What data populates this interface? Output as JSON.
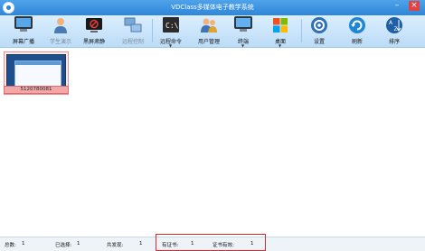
{
  "window": {
    "title": "VDClass多媒体电子教学系统"
  },
  "toolbar": {
    "items": [
      {
        "label": "屏幕广播",
        "icon": "monitor-broadcast-icon",
        "enabled": true
      },
      {
        "label": "学生演示",
        "icon": "student-demo-icon",
        "enabled": false
      },
      {
        "label": "黑屏肃静",
        "icon": "black-screen-icon",
        "enabled": true
      },
      {
        "label": "远程控制",
        "icon": "remote-control-icon",
        "enabled": false
      },
      {
        "label": "远程命令",
        "icon": "remote-command-icon",
        "enabled": true,
        "dropdown": true
      },
      {
        "label": "用户管理",
        "icon": "user-management-icon",
        "enabled": true
      },
      {
        "label": "终端",
        "icon": "terminal-icon",
        "enabled": true,
        "dropdown": true
      },
      {
        "label": "桌面",
        "icon": "desktop-icon",
        "enabled": true,
        "dropdown": true
      },
      {
        "label": "设置",
        "icon": "settings-icon",
        "enabled": true
      },
      {
        "label": "刷新",
        "icon": "refresh-icon",
        "enabled": true
      },
      {
        "label": "排序",
        "icon": "sort-icon",
        "enabled": true
      }
    ]
  },
  "students": [
    {
      "name": "5120780081"
    }
  ],
  "status": {
    "total_label": "总数:",
    "total_value": "1",
    "selected_label": "已选择:",
    "selected_value": "1",
    "found_label": "共发现:",
    "found_value": "1",
    "cert_label": "有证书:",
    "cert_value": "1",
    "valid_label": "证书有效:",
    "valid_value": "1"
  },
  "colors": {
    "accent": "#2f86d9",
    "highlight": "#d92d2d",
    "selection": "#f2a8a8"
  }
}
